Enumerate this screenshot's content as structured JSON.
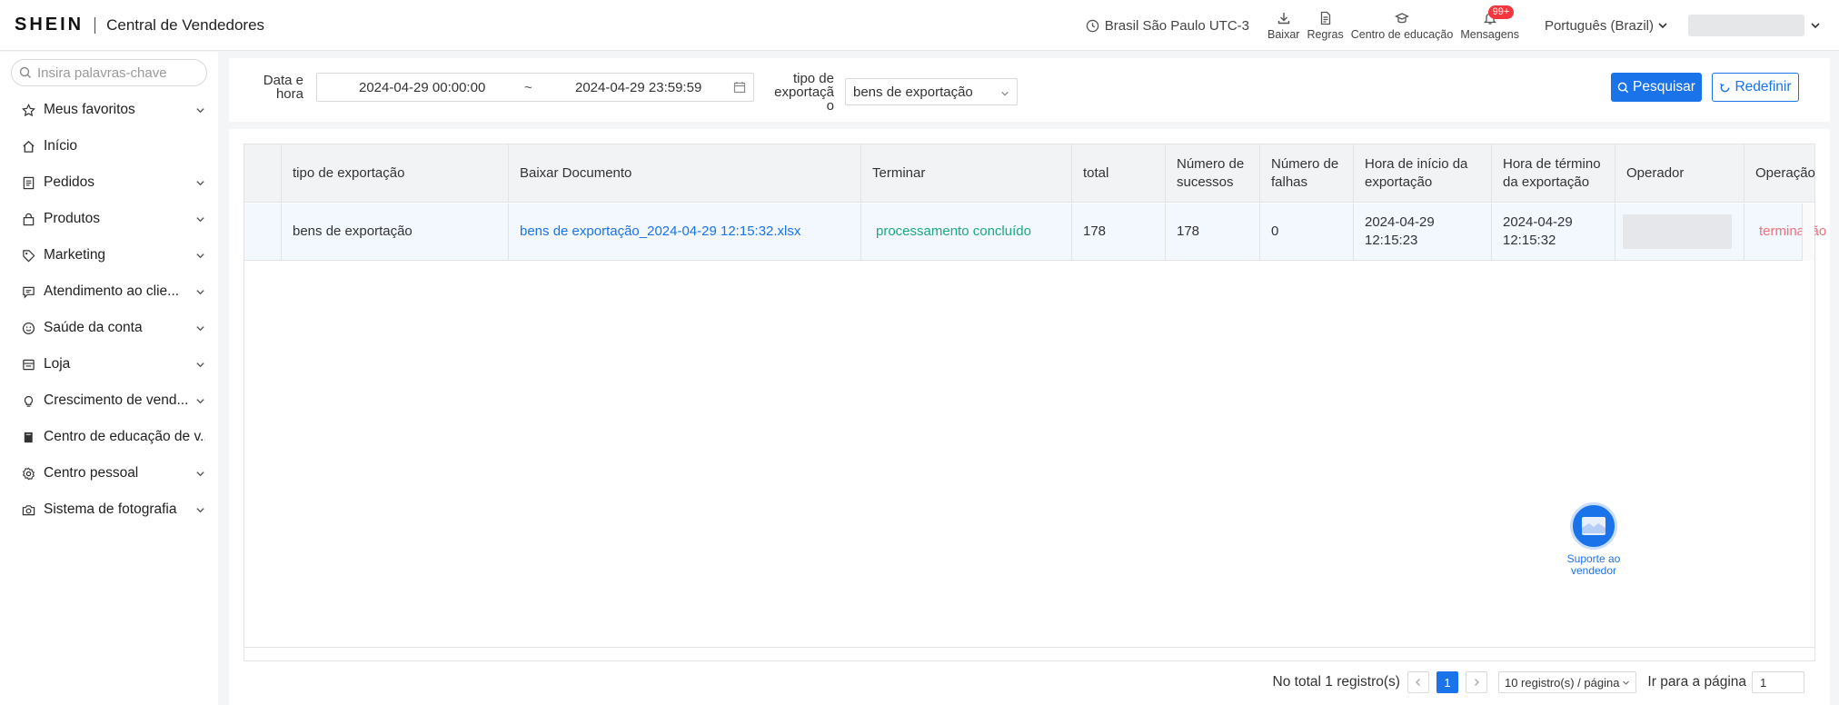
{
  "header": {
    "brand": "SHEIN",
    "title": "Central de Vendedores",
    "timezone": "Brasil São Paulo UTC-3",
    "tools": [
      {
        "label": "Baixar",
        "icon": "download-icon"
      },
      {
        "label": "Regras",
        "icon": "document-icon"
      },
      {
        "label": "Centro de educação",
        "icon": "graduation-cap-icon"
      },
      {
        "label": "Mensagens",
        "icon": "bell-icon",
        "badge": "99+"
      }
    ],
    "language": "Português (Brazil)"
  },
  "sidebar": {
    "search_placeholder": "Insira palavras-chave",
    "items": [
      {
        "label": "Meus favoritos",
        "icon": "star-icon",
        "expandable": true
      },
      {
        "label": "Início",
        "icon": "home-icon",
        "expandable": false
      },
      {
        "label": "Pedidos",
        "icon": "list-icon",
        "expandable": true
      },
      {
        "label": "Produtos",
        "icon": "bag-icon",
        "expandable": true
      },
      {
        "label": "Marketing",
        "icon": "tag-icon",
        "expandable": true
      },
      {
        "label": "Atendimento ao clie...",
        "icon": "chat-icon",
        "expandable": true
      },
      {
        "label": "Saúde da conta",
        "icon": "face-icon",
        "expandable": true
      },
      {
        "label": "Loja",
        "icon": "store-icon",
        "expandable": true
      },
      {
        "label": "Crescimento de vend...",
        "icon": "bulb-icon",
        "expandable": true
      },
      {
        "label": "Centro de educação de v...",
        "icon": "book-icon",
        "expandable": false
      },
      {
        "label": "Centro pessoal",
        "icon": "gear-icon",
        "expandable": true
      },
      {
        "label": "Sistema de fotografia",
        "icon": "camera-icon",
        "expandable": true
      }
    ]
  },
  "filters": {
    "date_label_line1": "Data e",
    "date_label_line2": "hora",
    "date_start": "2024-04-29 00:00:00",
    "date_separator": "~",
    "date_end": "2024-04-29 23:59:59",
    "type_label_line1": "tipo de",
    "type_label_line2": "exportaçã",
    "type_label_line3": "o",
    "type_value": "bens de exportação",
    "search_button": "Pesquisar",
    "reset_button": "Redefinir"
  },
  "table": {
    "columns": [
      {
        "line1": "tipo de exportação",
        "line2": ""
      },
      {
        "line1": "Baixar Documento",
        "line2": ""
      },
      {
        "line1": "Terminar",
        "line2": ""
      },
      {
        "line1": "total",
        "line2": ""
      },
      {
        "line1": "Número de",
        "line2": "sucessos"
      },
      {
        "line1": "Número de",
        "line2": "falhas"
      },
      {
        "line1": "Hora de início da",
        "line2": "exportação"
      },
      {
        "line1": "Hora de término",
        "line2": "da exportação"
      },
      {
        "line1": "Operador",
        "line2": ""
      },
      {
        "line1": "Operação",
        "line2": ""
      }
    ],
    "rows": [
      {
        "type": "bens de exportação",
        "document": "bens de exportação_2024-04-29 12:15:32.xlsx",
        "status": "processamento concluído",
        "total": "178",
        "successes": "178",
        "failures": "0",
        "start_date": "2024-04-29",
        "start_time": "12:15:23",
        "end_date": "2024-04-29",
        "end_time": "12:15:32",
        "operation": "terminação"
      }
    ]
  },
  "support": {
    "line1": "Suporte ao",
    "line2": "vendedor"
  },
  "pagination": {
    "total_text": "No total 1 registro(s)",
    "current_page": "1",
    "page_size": "10 registro(s) / página",
    "goto_label": "Ir para a página",
    "goto_value": "1"
  },
  "colors": {
    "primary": "#1a73e8",
    "success": "#1ca97c",
    "danger": "#f2707b",
    "badge": "#f5363e"
  }
}
